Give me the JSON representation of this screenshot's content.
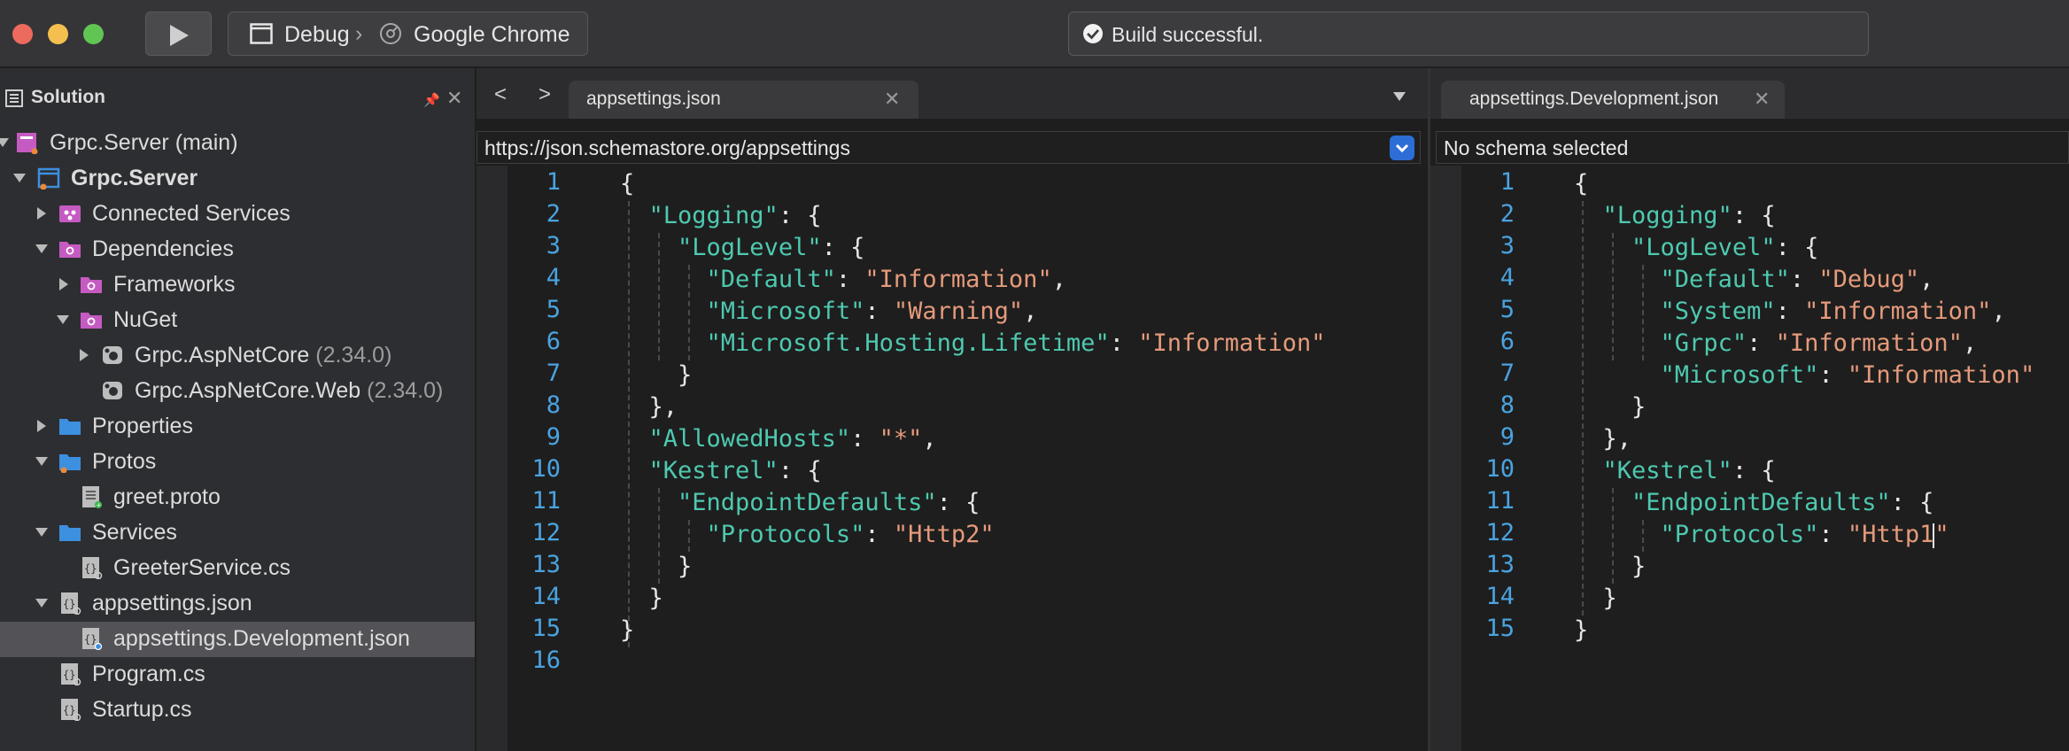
{
  "toolbar": {
    "configuration": "Debug",
    "target": "Google Chrome",
    "status": "Build successful."
  },
  "solution": {
    "title": "Solution",
    "items": [
      {
        "label": "Grpc.Server (main)",
        "version": ""
      },
      {
        "label": "Grpc.Server",
        "version": ""
      },
      {
        "label": "Connected Services",
        "version": ""
      },
      {
        "label": "Dependencies",
        "version": ""
      },
      {
        "label": "Frameworks",
        "version": ""
      },
      {
        "label": "NuGet",
        "version": ""
      },
      {
        "label": "Grpc.AspNetCore",
        "version": "(2.34.0)"
      },
      {
        "label": "Grpc.AspNetCore.Web",
        "version": "(2.34.0)"
      },
      {
        "label": "Properties",
        "version": ""
      },
      {
        "label": "Protos",
        "version": ""
      },
      {
        "label": "greet.proto",
        "version": ""
      },
      {
        "label": "Services",
        "version": ""
      },
      {
        "label": "GreeterService.cs",
        "version": ""
      },
      {
        "label": "appsettings.json",
        "version": ""
      },
      {
        "label": "appsettings.Development.json",
        "version": ""
      },
      {
        "label": "Program.cs",
        "version": ""
      },
      {
        "label": "Startup.cs",
        "version": ""
      }
    ]
  },
  "left_editor": {
    "tab": "appsettings.json",
    "schema": "https://json.schemastore.org/appsettings",
    "lines": [
      "1",
      "2",
      "3",
      "4",
      "5",
      "6",
      "7",
      "8",
      "9",
      "10",
      "11",
      "12",
      "13",
      "14",
      "15",
      "16"
    ]
  },
  "right_editor": {
    "tab": "appsettings.Development.json",
    "schema": "No schema selected",
    "lines": [
      "1",
      "2",
      "3",
      "4",
      "5",
      "6",
      "7",
      "8",
      "9",
      "10",
      "11",
      "12",
      "13",
      "14",
      "15"
    ]
  }
}
